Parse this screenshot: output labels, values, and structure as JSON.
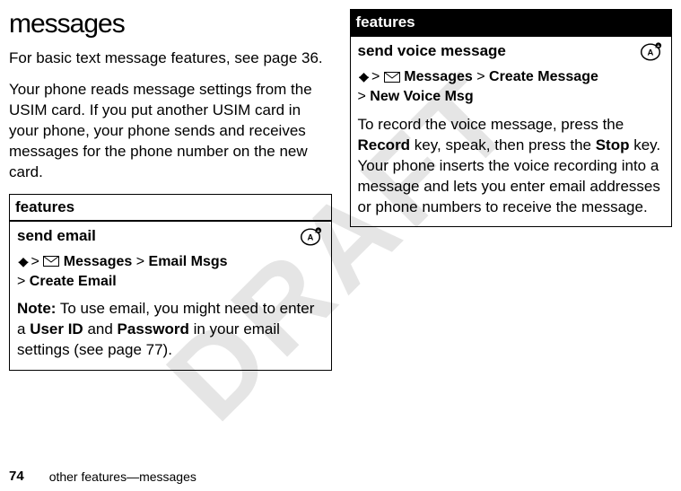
{
  "watermark": "DRAFT",
  "heading": "messages",
  "intro1": "For basic text message features, see page 36.",
  "intro2": "Your phone reads message settings from the USIM card. If you put another USIM card in your phone, your phone sends and receives messages for the phone number on the new card.",
  "leftBox": {
    "header": "features",
    "title": "send email",
    "path": {
      "messages": "Messages",
      "emailMsgs": "Email Msgs",
      "createEmail": "Create Email"
    },
    "note": {
      "label": "Note:",
      "before": " To use email, you might need to enter a ",
      "userID": "User ID",
      "mid": " and ",
      "password": "Password",
      "after": " in your email settings (see page 77)."
    }
  },
  "rightBox": {
    "header": "features",
    "title": "send voice message",
    "path": {
      "messages": "Messages",
      "createMessage": "Create Message",
      "newVoiceMsg": "New Voice Msg"
    },
    "desc": {
      "p1": "To record the voice message, press the ",
      "record": "Record",
      "p2": " key, speak, then press the ",
      "stop": "Stop",
      "p3": " key. Your phone inserts the voice recording into a message and lets you enter email addresses or phone numbers to receive the message."
    }
  },
  "footer": {
    "pageNum": "74",
    "text": "other features—messages"
  }
}
